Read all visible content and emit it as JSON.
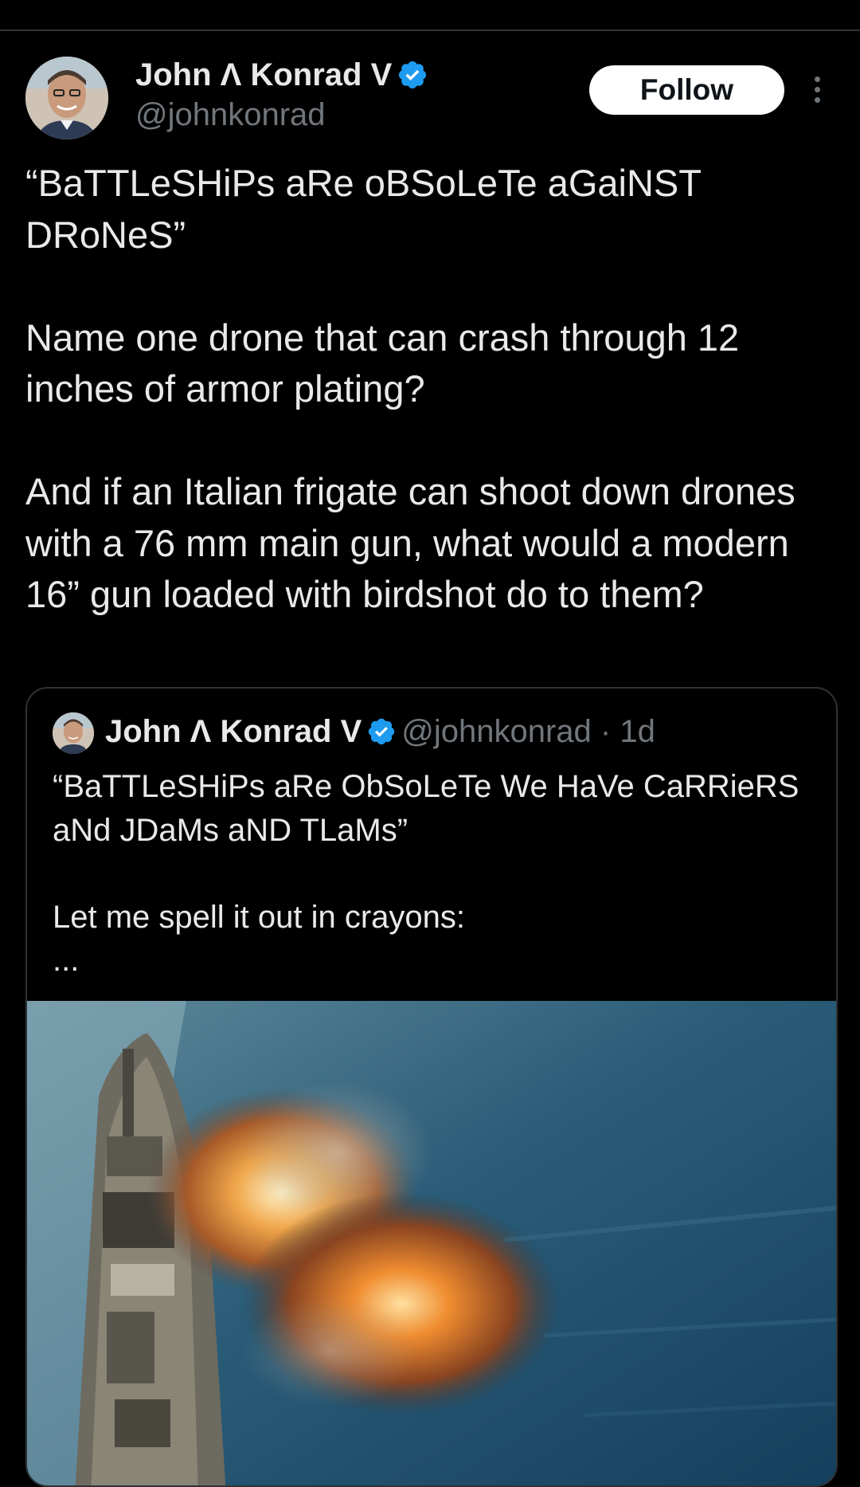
{
  "tweet": {
    "author": {
      "name": "John Λ Konrad V",
      "handle": "@johnkonrad",
      "avatar_icon": "profile-photo",
      "verified_icon": "verified-badge-icon"
    },
    "follow_label": "Follow",
    "more_icon": "more-vertical-icon",
    "text": "“BaTTLeSHiPs aRe oBSoLeTe aGaiNST DRoNeS”\n\nName one drone that can crash through 12 inches of armor plating?\n\nAnd if an Italian frigate can shoot down drones with a 76 mm main gun, what would a modern 16” gun loaded with birdshot do to them?"
  },
  "quote": {
    "author_name": "John Λ Konrad V",
    "handle": "@johnkonrad",
    "separator": "·",
    "time": "1d",
    "text": "“BaTTLeSHiPs aRe ObSoLeTe We HaVe CaRRieRS aNd JDaMs aND TLaMs”\n\nLet me spell it out in crayons:\n...",
    "media_description_icon": "battleship-firing-image"
  },
  "colors": {
    "background": "#000000",
    "text": "#e7e9ea",
    "muted": "#71767b",
    "verified": "#1d9bf0",
    "border": "#2f3336"
  }
}
